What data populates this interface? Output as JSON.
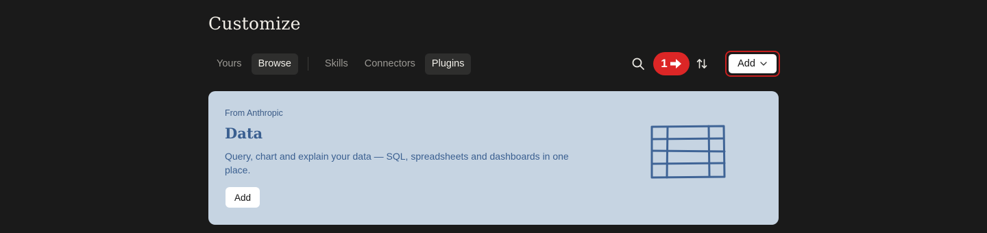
{
  "page": {
    "title": "Customize"
  },
  "tabs": {
    "group1": [
      {
        "label": "Yours",
        "active": false
      },
      {
        "label": "Browse",
        "active": true
      }
    ],
    "group2": [
      {
        "label": "Skills",
        "active": false
      },
      {
        "label": "Connectors",
        "active": false
      },
      {
        "label": "Plugins",
        "active": true
      }
    ]
  },
  "toolbar": {
    "search_icon": "search-icon",
    "step_badge": {
      "number": "1",
      "icon": "arrow-right-icon"
    },
    "sort_icon": "sort-arrows-icon",
    "add_label": "Add",
    "add_icon": "chevron-down-icon"
  },
  "colors": {
    "background": "#1a1a1a",
    "card_background": "#c6d4e2",
    "accent_blue": "#3a5f90",
    "highlight_red": "#dc2626"
  },
  "featured": {
    "source": "From Anthropic",
    "title": "Data",
    "description": "Query, chart and explain your data — SQL, spreadsheets and dashboards in one place.",
    "add_label": "Add",
    "illustration": "table-grid-icon"
  }
}
